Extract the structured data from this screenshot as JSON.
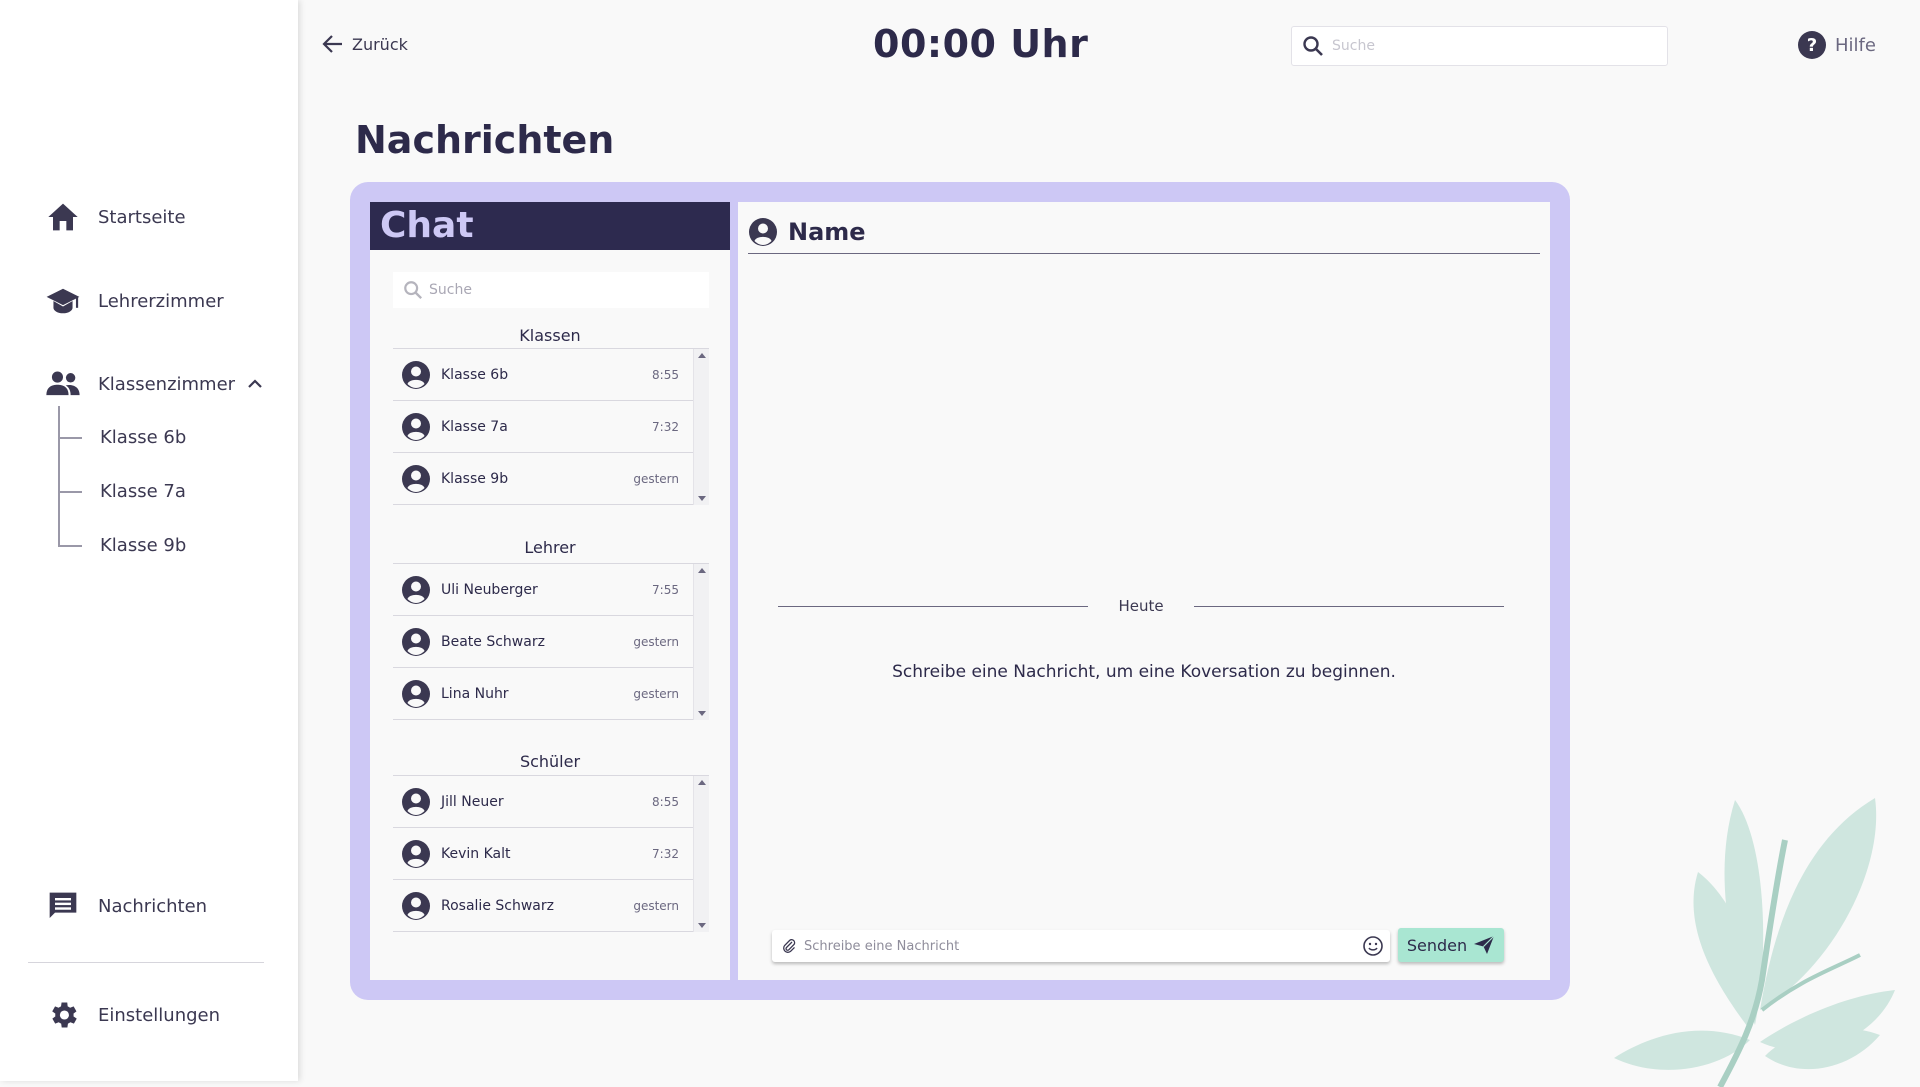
{
  "sidebar": {
    "items": [
      {
        "label": "Startseite",
        "icon": "home-icon"
      },
      {
        "label": "Lehrerzimmer",
        "icon": "graduation-cap-icon"
      },
      {
        "label": "Klassenzimmer",
        "icon": "group-icon"
      }
    ],
    "sub_items": [
      "Klasse 6b",
      "Klasse 7a",
      "Klasse 9b"
    ],
    "messages_label": "Nachrichten",
    "settings_label": "Einstellungen"
  },
  "topbar": {
    "back_label": "Zurück",
    "clock": "00:00 Uhr",
    "search_placeholder": "Suche",
    "help_label": "Hilfe"
  },
  "page": {
    "title": "Nachrichten"
  },
  "chat_list": {
    "header": "Chat",
    "search_placeholder": "Suche",
    "sections": [
      {
        "title": "Klassen",
        "rows": [
          {
            "name": "Klasse 6b",
            "time": "8:55"
          },
          {
            "name": "Klasse 7a",
            "time": "7:32"
          },
          {
            "name": "Klasse 9b",
            "time": "gestern"
          }
        ]
      },
      {
        "title": "Lehrer",
        "rows": [
          {
            "name": "Uli Neuberger",
            "time": "7:55"
          },
          {
            "name": "Beate Schwarz",
            "time": "gestern"
          },
          {
            "name": "Lina Nuhr",
            "time": "gestern"
          }
        ]
      },
      {
        "title": "Schüler",
        "rows": [
          {
            "name": "Jill Neuer",
            "time": "8:55"
          },
          {
            "name": "Kevin Kalt",
            "time": "7:32"
          },
          {
            "name": "Rosalie Schwarz",
            "time": "gestern"
          }
        ]
      }
    ]
  },
  "conversation": {
    "name": "Name",
    "day_label": "Heute",
    "empty_message": "Schreibe eine Nachricht, um eine Koversation zu beginnen.",
    "compose_placeholder": "Schreibe eine Nachricht",
    "send_label": "Senden"
  },
  "colors": {
    "primary_dark": "#2d2a4f",
    "panel_lavender": "#cdc8f5",
    "send_mint": "#a9e6d2",
    "plant": "#cfe6df"
  }
}
